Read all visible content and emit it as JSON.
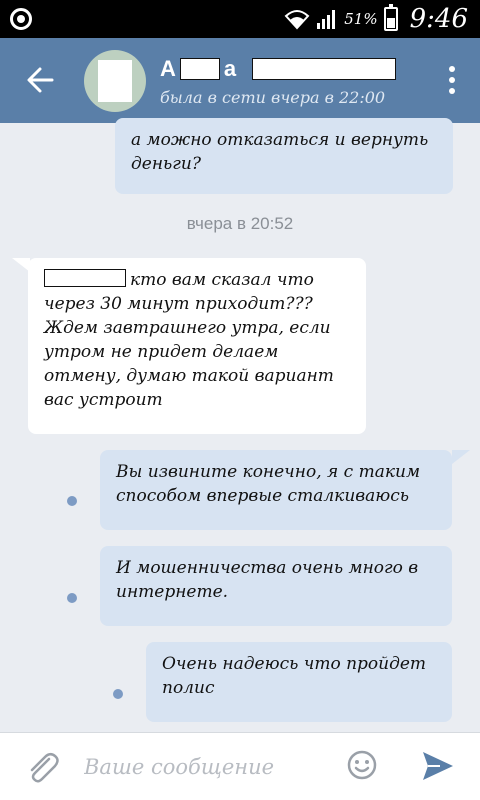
{
  "status_bar": {
    "battery_percent": "51%",
    "time": "9:46",
    "icons": [
      "app-badge-icon",
      "wifi-icon",
      "signal-icon",
      "battery-icon"
    ]
  },
  "header": {
    "contact_name_start": "А",
    "contact_name_mid": "а",
    "contact_status": "была в сети вчера в 22:00",
    "icons": [
      "back-arrow-icon",
      "more-vert-icon"
    ]
  },
  "messages": [
    {
      "direction": "out",
      "text": "а можно отказаться и вернуть деньги?"
    },
    {
      "type": "date",
      "text": "вчера в 20:52"
    },
    {
      "direction": "in",
      "text": "кто вам сказал что через 30 минут приходит??? Ждем завтрашнего утра, если утром не придет делаем отмену, думаю такой вариант вас устроит"
    },
    {
      "direction": "out",
      "text": "Вы извините конечно, я с таким способом впервые сталкиваюсь",
      "unread": true
    },
    {
      "direction": "out",
      "text": "И мошенничества очень много в интернете.",
      "unread": true
    },
    {
      "direction": "out",
      "text": "Очень надеюсь что пройдет полис",
      "unread": true
    }
  ],
  "composer": {
    "placeholder": "Ваше сообщение",
    "value": "",
    "icons": [
      "paperclip-icon",
      "emoji-icon",
      "send-icon"
    ]
  },
  "colors": {
    "header": "#5a7fa8",
    "background": "#eaedf2",
    "outgoing_bubble": "#d7e3f2",
    "incoming_bubble": "#ffffff",
    "unread_dot": "#7d9bc4",
    "send_icon": "#5a7fa8"
  }
}
